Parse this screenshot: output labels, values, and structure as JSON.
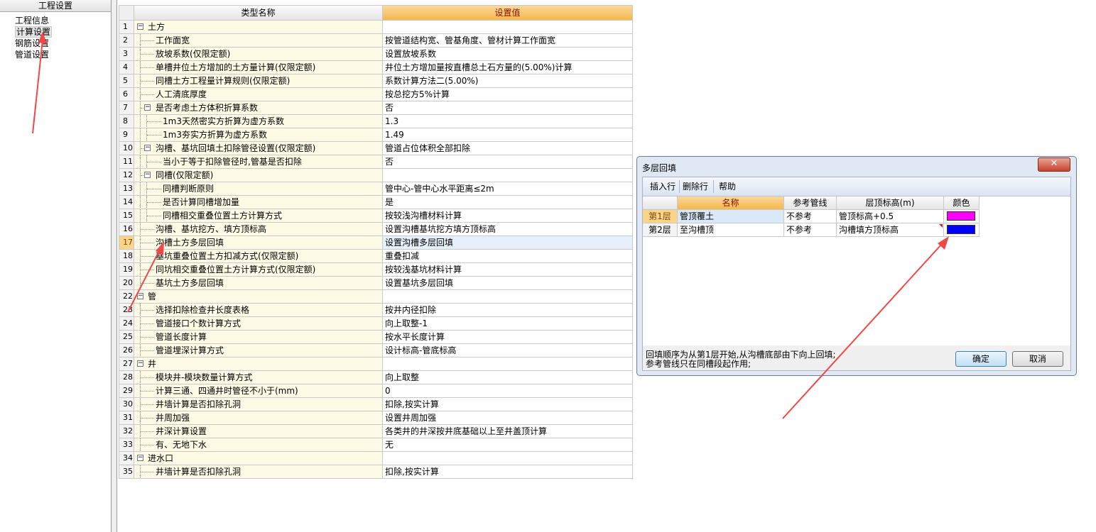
{
  "left_panel": {
    "title": "工程设置",
    "items": [
      {
        "label": "工程信息"
      },
      {
        "label": "计算设置"
      },
      {
        "label": "钢筋设置"
      },
      {
        "label": "管道设置"
      }
    ]
  },
  "grid": {
    "headers": {
      "name": "类型名称",
      "value": "设置值"
    },
    "selected_row": "17",
    "rows": [
      {
        "no": "1",
        "level": 0,
        "toggle": true,
        "name": "土方",
        "value": ""
      },
      {
        "no": "2",
        "level": 1,
        "name": "工作面宽",
        "value": "按管道结构宽、管基角度、管材计算工作面宽"
      },
      {
        "no": "3",
        "level": 1,
        "name": "放坡系数(仅限定额)",
        "value": "设置放坡系数"
      },
      {
        "no": "4",
        "level": 1,
        "name": "单槽井位土方增加的土方量计算(仅限定额)",
        "value": "井位土方增加量按直槽总土石方量的(5.00%)计算"
      },
      {
        "no": "5",
        "level": 1,
        "name": "同槽土方工程量计算规则(仅限定额)",
        "value": "系数计算方法二(5.00%)"
      },
      {
        "no": "6",
        "level": 1,
        "name": "人工清底厚度",
        "value": "按总挖方5%计算"
      },
      {
        "no": "7",
        "level": 1,
        "toggle": true,
        "name": "是否考虑土方体积折算系数",
        "value": "否"
      },
      {
        "no": "8",
        "level": 2,
        "name": "1m3天然密实方折算为虚方系数",
        "value": "1.3"
      },
      {
        "no": "9",
        "level": 2,
        "name": "1m3夯实方折算为虚方系数",
        "value": "1.49"
      },
      {
        "no": "10",
        "level": 1,
        "toggle": true,
        "name": "沟槽、基坑回填土扣除管径设置(仅限定额)",
        "value": "管道占位体积全部扣除"
      },
      {
        "no": "11",
        "level": 2,
        "name": "当小于等于扣除管径时,管基是否扣除",
        "value": "否"
      },
      {
        "no": "12",
        "level": 1,
        "toggle": true,
        "name": "同槽(仅限定额)",
        "value": ""
      },
      {
        "no": "13",
        "level": 2,
        "name": "同槽判断原则",
        "value": "管中心-管中心水平距离≤2m"
      },
      {
        "no": "14",
        "level": 2,
        "name": "是否计算同槽增加量",
        "value": "是"
      },
      {
        "no": "15",
        "level": 2,
        "name": "同槽相交重叠位置土方计算方式",
        "value": "按较浅沟槽材料计算"
      },
      {
        "no": "16",
        "level": 1,
        "name": "沟槽、基坑挖方、填方顶标高",
        "value": "设置沟槽基坑挖方填方顶标高"
      },
      {
        "no": "17",
        "level": 1,
        "name": "沟槽土方多层回填",
        "value": "设置沟槽多层回填"
      },
      {
        "no": "18",
        "level": 1,
        "name": "基坑重叠位置土方扣减方式(仅限定额)",
        "value": "重叠扣减"
      },
      {
        "no": "19",
        "level": 1,
        "name": "同坑相交重叠位置土方计算方式(仅限定额)",
        "value": "按较浅基坑材料计算"
      },
      {
        "no": "20",
        "level": 1,
        "name": "基坑土方多层回填",
        "value": "设置基坑多层回填"
      },
      {
        "no": "22",
        "level": 0,
        "toggle": true,
        "name": "管",
        "value": ""
      },
      {
        "no": "23",
        "level": 1,
        "name": "选择扣除检查井长度表格",
        "value": "按井内径扣除"
      },
      {
        "no": "24",
        "level": 1,
        "name": "管道接口个数计算方式",
        "value": "向上取整-1"
      },
      {
        "no": "25",
        "level": 1,
        "name": "管道长度计算",
        "value": "按水平长度计算"
      },
      {
        "no": "26",
        "level": 1,
        "name": "管道埋深计算方式",
        "value": "设计标高-管底标高"
      },
      {
        "no": "27",
        "level": 0,
        "toggle": true,
        "name": "井",
        "value": ""
      },
      {
        "no": "28",
        "level": 1,
        "name": "模块井-模块数量计算方式",
        "value": "向上取整"
      },
      {
        "no": "29",
        "level": 1,
        "name": "计算三通、四通井时管径不小于(mm)",
        "value": "0"
      },
      {
        "no": "30",
        "level": 1,
        "name": "井墙计算是否扣除孔洞",
        "value": "扣除,按实计算"
      },
      {
        "no": "31",
        "level": 1,
        "name": "井周加强",
        "value": "设置井周加强"
      },
      {
        "no": "32",
        "level": 1,
        "name": "井深计算设置",
        "value": "各类井的井深按井底基础以上至井盖顶计算"
      },
      {
        "no": "33",
        "level": 1,
        "name": "有、无地下水",
        "value": "无"
      },
      {
        "no": "34",
        "level": 0,
        "toggle": true,
        "name": "进水口",
        "value": ""
      },
      {
        "no": "35",
        "level": 1,
        "name": "井墙计算是否扣除孔洞",
        "value": "扣除,按实计算"
      }
    ]
  },
  "dialog": {
    "title": "多层回填",
    "close_label": "✕",
    "toolbar": {
      "insert": "插入行",
      "delete": "删除行",
      "help": "帮助"
    },
    "headers": {
      "name": "名称",
      "ref": "参考管线",
      "elev": "层顶标高(m)",
      "color": "颜色"
    },
    "rows": [
      {
        "no": "第1层",
        "name": "管顶覆土",
        "ref": "不参考",
        "elev": "管顶标高+0.5",
        "color": "#ff00ff"
      },
      {
        "no": "第2层",
        "name": "至沟槽顶",
        "ref": "不参考",
        "elev": "沟槽填方顶标高",
        "color": "#0000ff"
      }
    ],
    "note_line1": "回填顺序为从第1层开始,从沟槽底部由下向上回填;",
    "note_line2": "参考管线只在同槽段起作用;",
    "ok_label": "确定",
    "cancel_label": "取消"
  },
  "colors": {
    "arrow": "#f04848",
    "header_accent": "#f4b84e"
  }
}
